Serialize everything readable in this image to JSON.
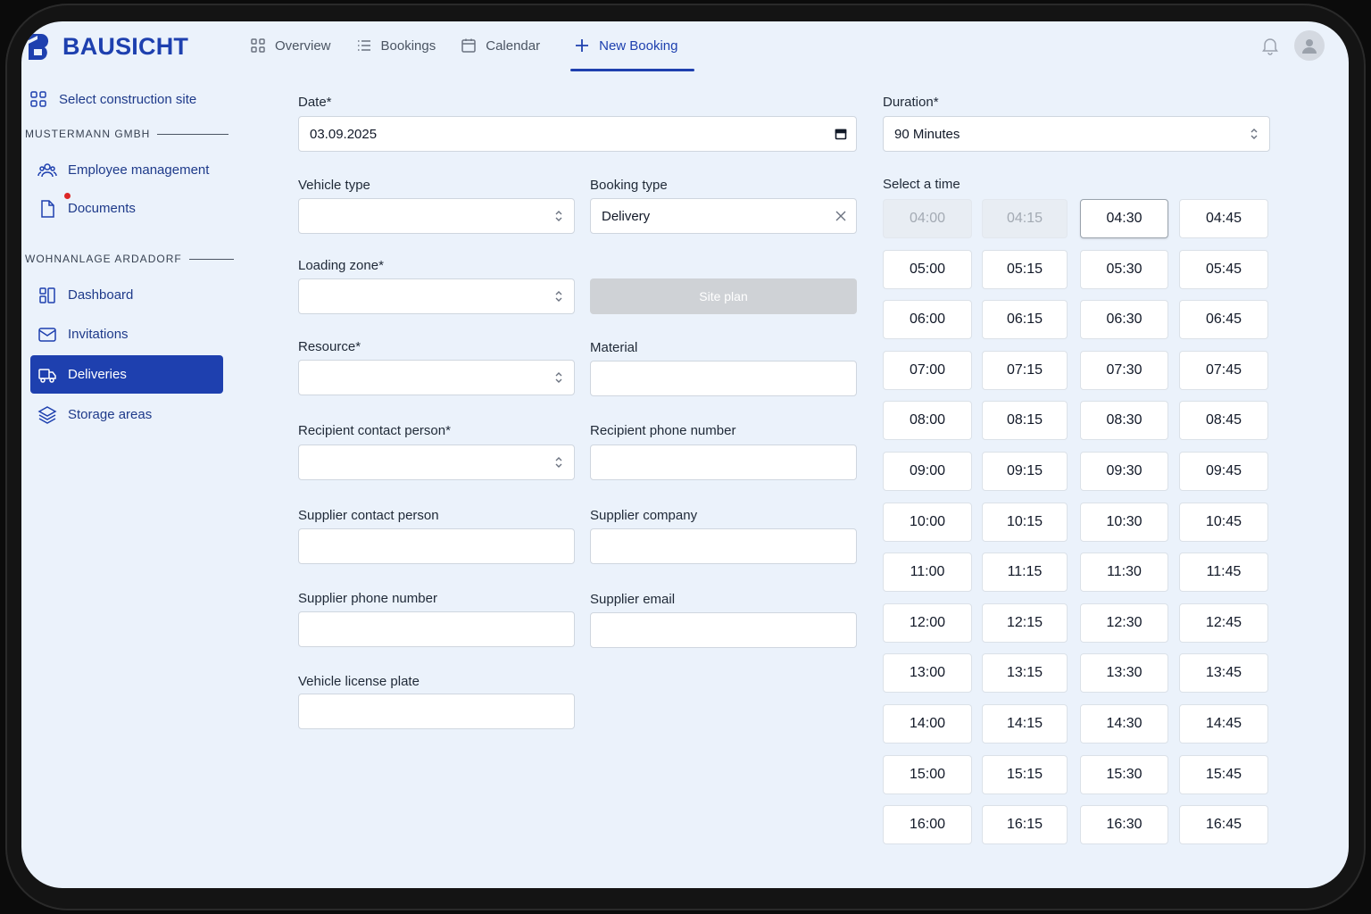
{
  "brand": {
    "name": "BAUSICHT",
    "accent": "#1e40af"
  },
  "topnav": [
    {
      "label": "Overview",
      "icon": "grid-icon"
    },
    {
      "label": "Bookings",
      "icon": "list-icon"
    },
    {
      "label": "Calendar",
      "icon": "calendar-icon"
    },
    {
      "label": "New Booking",
      "icon": "plus-icon",
      "active": true
    }
  ],
  "sidebar": {
    "select_site": "Select construction site",
    "sections": [
      {
        "title": "MUSTERMANN GMBH",
        "items": [
          {
            "label": "Employee management",
            "icon": "users-icon"
          },
          {
            "label": "Documents",
            "icon": "document-icon",
            "badge": true
          }
        ]
      },
      {
        "title": "WOHNANLAGE ARDADORF",
        "items": [
          {
            "label": "Dashboard",
            "icon": "dashboard-icon"
          },
          {
            "label": "Invitations",
            "icon": "mail-icon"
          },
          {
            "label": "Deliveries",
            "icon": "truck-icon",
            "active": true
          },
          {
            "label": "Storage areas",
            "icon": "layers-icon"
          }
        ]
      }
    ]
  },
  "form": {
    "date": {
      "label": "Date*",
      "value": "03.09.2025"
    },
    "vehicle_type": {
      "label": "Vehicle type",
      "value": ""
    },
    "booking_type": {
      "label": "Booking type",
      "value": "Delivery"
    },
    "loading_zone": {
      "label": "Loading zone*",
      "value": ""
    },
    "site_plan": {
      "label": "Site plan"
    },
    "resource": {
      "label": "Resource*",
      "value": ""
    },
    "material": {
      "label": "Material",
      "value": ""
    },
    "recipient_contact": {
      "label": "Recipient contact person*",
      "value": ""
    },
    "recipient_phone": {
      "label": "Recipient phone number",
      "value": ""
    },
    "supplier_contact": {
      "label": "Supplier contact person",
      "value": ""
    },
    "supplier_company": {
      "label": "Supplier company",
      "value": ""
    },
    "supplier_phone": {
      "label": "Supplier phone number",
      "value": ""
    },
    "supplier_email": {
      "label": "Supplier email",
      "value": ""
    },
    "license_plate": {
      "label": "Vehicle license plate",
      "value": ""
    }
  },
  "duration": {
    "label": "Duration*",
    "value": "90 Minutes"
  },
  "time": {
    "label": "Select a time",
    "selected": "04:30",
    "disabled": [
      "04:00",
      "04:15"
    ],
    "slots": [
      "04:00",
      "04:15",
      "04:30",
      "04:45",
      "05:00",
      "05:15",
      "05:30",
      "05:45",
      "06:00",
      "06:15",
      "06:30",
      "06:45",
      "07:00",
      "07:15",
      "07:30",
      "07:45",
      "08:00",
      "08:15",
      "08:30",
      "08:45",
      "09:00",
      "09:15",
      "09:30",
      "09:45",
      "10:00",
      "10:15",
      "10:30",
      "10:45",
      "11:00",
      "11:15",
      "11:30",
      "11:45",
      "12:00",
      "12:15",
      "12:30",
      "12:45",
      "13:00",
      "13:15",
      "13:30",
      "13:45",
      "14:00",
      "14:15",
      "14:30",
      "14:45",
      "15:00",
      "15:15",
      "15:30",
      "15:45",
      "16:00",
      "16:15",
      "16:30",
      "16:45"
    ]
  }
}
